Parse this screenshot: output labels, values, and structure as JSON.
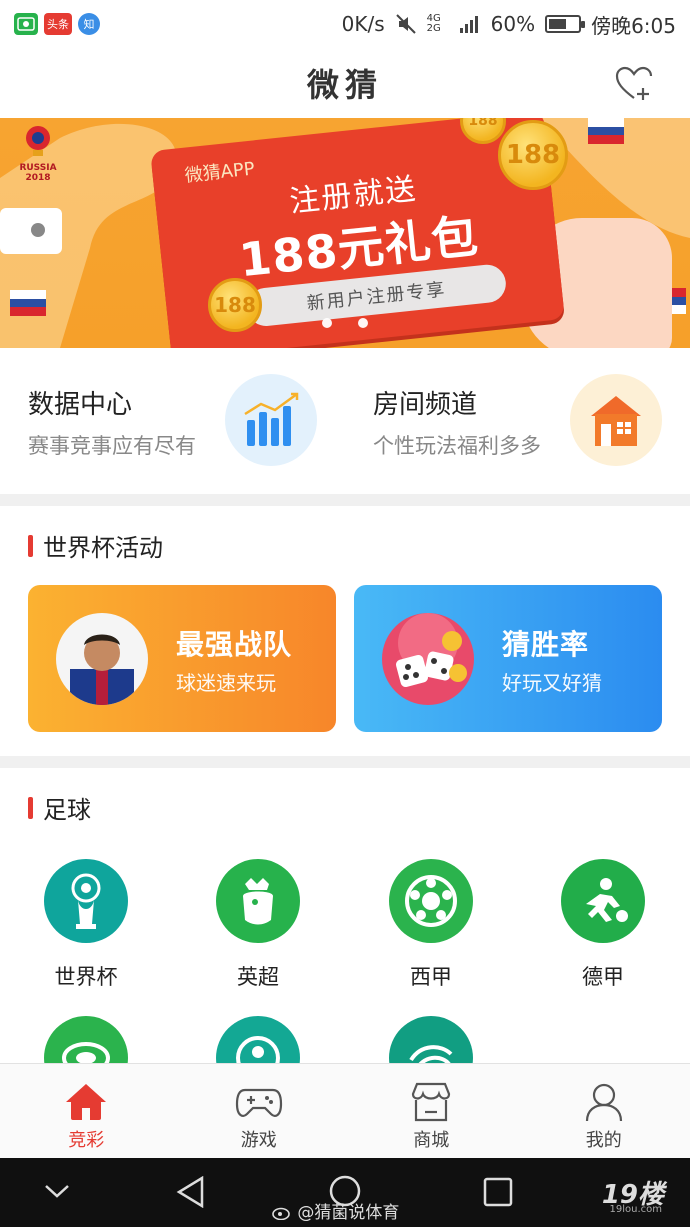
{
  "status_bar": {
    "net_speed": "0K/s",
    "network": "4G 2G",
    "battery": "60%",
    "battery_level": 0.6,
    "time": "傍晚6:05",
    "left_badges": [
      "头条",
      "知"
    ]
  },
  "header": {
    "title": "微猜"
  },
  "banner": {
    "app_label": "微猜APP",
    "line1": "注册就送",
    "line2": "188元礼包",
    "pill": "新用户注册专享",
    "coin_text": "188",
    "worldcup_text": "RUSSIA 2018",
    "dots": 3,
    "active_dot": 1
  },
  "quick_entries": [
    {
      "title": "数据中心",
      "subtitle": "赛事竞事应有尽有",
      "icon": "bar-chart-icon"
    },
    {
      "title": "房间频道",
      "subtitle": "个性玩法福利多多",
      "icon": "house-icon"
    }
  ],
  "worldcup_section": {
    "title": "世界杯活动",
    "cards": [
      {
        "title": "最强战队",
        "subtitle": "球迷速来玩",
        "icon": "player-avatar",
        "gradient": [
          "#fbb231",
          "#f7862a"
        ]
      },
      {
        "title": "猜胜率",
        "subtitle": "好玩又好猜",
        "icon": "dice-avatar",
        "gradient": [
          "#49b9f6",
          "#2b8cf0"
        ]
      }
    ]
  },
  "football_section": {
    "title": "足球",
    "leagues": [
      {
        "label": "世界杯",
        "icon": "world-cup-icon",
        "color": "#0fa59c"
      },
      {
        "label": "英超",
        "icon": "premier-league-icon",
        "color": "#27b24c"
      },
      {
        "label": "西甲",
        "icon": "la-liga-icon",
        "color": "#2bb34d"
      },
      {
        "label": "德甲",
        "icon": "bundesliga-icon",
        "color": "#22ad4a"
      }
    ],
    "partial_row_icons": [
      "csl-icon",
      "serie-a-icon",
      "ligue-icon"
    ]
  },
  "bottom_nav": [
    {
      "label": "竞彩",
      "icon": "home-icon",
      "active": true
    },
    {
      "label": "游戏",
      "icon": "gamepad-icon",
      "active": false
    },
    {
      "label": "商城",
      "icon": "shop-icon",
      "active": false
    },
    {
      "label": "我的",
      "icon": "user-icon",
      "active": false
    }
  ],
  "watermark": {
    "text": "@猜菌说体育",
    "logo": "19楼",
    "logo_sub": "19lou.com"
  },
  "colors": {
    "accent": "#e53b32",
    "banner_bg": "#f7a431",
    "ticket": "#e8402a"
  }
}
